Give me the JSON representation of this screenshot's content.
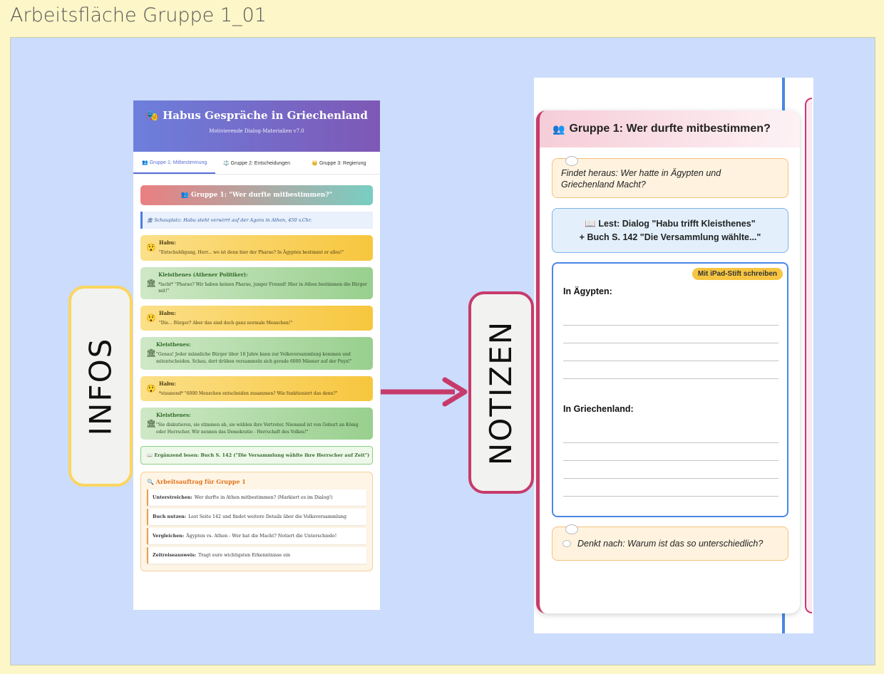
{
  "page": {
    "title": "Arbeitsfläche Gruppe 1_01"
  },
  "labels": {
    "infos": "INFOS",
    "notizen": "NOTIZEN"
  },
  "left_doc": {
    "header_icon": "🎭",
    "title": "Habus Gespräche in Griechenland",
    "subtitle": "Motivierende Dialog-Materialien v7.0",
    "tabs": [
      {
        "label": "👥 Gruppe 1: Mitbestimmung",
        "active": true
      },
      {
        "label": "⚖️ Gruppe 2: Entscheidungen",
        "active": false
      },
      {
        "label": "👑 Gruppe 3: Regierung",
        "active": false
      }
    ],
    "group_title": "👥 Gruppe 1: \"Wer durfte mitbestimmen?\"",
    "scene": "🏛 Schauplatz: Habu steht verwirrt auf der Agora in Athen, 450 v.Chr.",
    "dialog": [
      {
        "speaker": "Habu:",
        "icon": "😲",
        "text": "\"Entschuldigung, Herr... wo ist denn hier der Pharao? In Ägypten bestimmt er alles!\"",
        "kind": "habu"
      },
      {
        "speaker": "Kleisthenes (Athener Politiker):",
        "icon": "🏛",
        "text": "*lacht* \"Pharao? Wir haben keinen Pharao, junger Freund! Hier in Athen bestimmen die Bürger mit!\"",
        "kind": "kl"
      },
      {
        "speaker": "Habu:",
        "icon": "😲",
        "text": "\"Die... Bürger? Aber das sind doch ganz normale Menschen!\"",
        "kind": "habu"
      },
      {
        "speaker": "Kleisthenes:",
        "icon": "🏛",
        "text": "\"Genau! Jeder männliche Bürger über 18 Jahre kann zur Volksversammlung kommen und mitentscheiden. Schau, dort drüben versammeln sich gerade 6000 Männer auf der Pnyx!\"",
        "kind": "kl"
      },
      {
        "speaker": "Habu:",
        "icon": "😲",
        "text": "*staunend* \"6000 Menschen entscheiden zusammen? Wie funktioniert das denn?\"",
        "kind": "habu"
      },
      {
        "speaker": "Kleisthenes:",
        "icon": "🏛",
        "text": "\"Sie diskutieren, sie stimmen ab, sie wählen ihre Vertreter. Niemand ist von Geburt an König oder Herrscher. Wir nennen das Demokratie - Herrschaft des Volkes!\"",
        "kind": "kl"
      }
    ],
    "extra_reading": "📖 Ergänzend lesen: Buch S. 142 (\"Die Versammlung wählte ihre Herrscher auf Zeit\")",
    "task": {
      "heading": "🔍 Arbeitsauftrag für Gruppe 1",
      "items": [
        {
          "bold": "Unterstreichen:",
          "text": "Wer durfte in Athen mitbestimmen? (Markiert es im Dialog!)"
        },
        {
          "bold": "Buch nutzen:",
          "text": "Lest Seite 142 und findet weitere Details über die Volksversammlung"
        },
        {
          "bold": "Vergleichen:",
          "text": "Ägypten vs. Athen - Wer hat die Macht? Notiert die Unterschiede!"
        },
        {
          "bold": "Zeitreiseausweis:",
          "text": "Tragt eure wichtigsten Erkenntnisse ein"
        }
      ]
    }
  },
  "right_doc": {
    "header_icon": "👥",
    "title": "Gruppe 1: Wer durfte mitbestimmen?",
    "prompt_line1": "Findet heraus: Wer hatte in Ägypten und",
    "prompt_line2": "Griechenland Macht?",
    "read_line1": "📖 Lest: Dialog \"Habu trifft Kleisthenes\"",
    "read_line2": "+ Buch S. 142 \"Die Versammlung wählte...\"",
    "badge": "Mit iPad-Stift schreiben",
    "label_egypt": "In Ägypten:",
    "label_greece": "In Griechenland:",
    "reflect": "Denkt nach: Warum ist das so unterschiedlich?"
  },
  "colors": {
    "infos_border": "#fbd55f",
    "notizen_border": "#c63b6b",
    "arrow": "#c63b6b",
    "board": "#ccdcfc",
    "page": "#fdf6c8"
  }
}
